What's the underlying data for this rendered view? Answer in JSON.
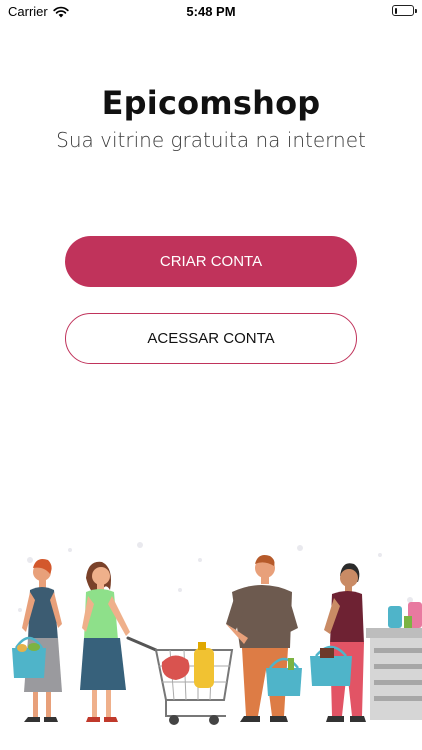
{
  "status_bar": {
    "carrier": "Carrier",
    "time": "5:48 PM",
    "battery_level": 0.15
  },
  "header": {
    "title": "Epicomshop",
    "subtitle": "Sua vitrine gratuita na internet"
  },
  "actions": {
    "create_account_label": "CRIAR CONTA",
    "access_account_label": "ACESSAR CONTA"
  },
  "colors": {
    "accent": "#c0335b",
    "background": "#ffffff"
  },
  "icons": [
    "wifi-icon",
    "battery-icon"
  ],
  "illustration": {
    "subject": "shoppers-queue-illustration"
  }
}
